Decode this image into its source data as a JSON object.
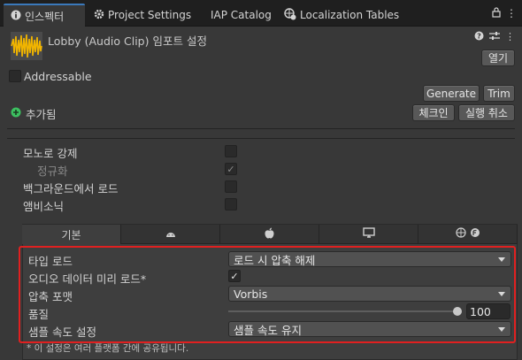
{
  "tabs": [
    {
      "label": "인스펙터",
      "icon": "info-icon"
    },
    {
      "label": "Project Settings",
      "icon": "gear-icon"
    },
    {
      "label": "IAP Catalog",
      "icon": ""
    },
    {
      "label": "Localization Tables",
      "icon": "globe-icon"
    }
  ],
  "header": {
    "title": "Lobby (Audio Clip) 임포트 설정",
    "open_label": "열기",
    "addressable_label": "Addressable",
    "generate_label": "Generate",
    "trim_label": "Trim",
    "added_label": "추가됨",
    "checkin_label": "체크인",
    "undo_label": "실행 취소"
  },
  "settings": {
    "mono_label": "모노로 강제",
    "mono_checked": false,
    "normalize_label": "정규화",
    "normalize_checked": true,
    "background_label": "백그라운드에서 로드",
    "background_checked": false,
    "ambisonic_label": "앰비소닉",
    "ambisonic_checked": false
  },
  "platform_tabs": [
    {
      "label": "기본",
      "icon": ""
    },
    {
      "label": "",
      "icon": "android-icon"
    },
    {
      "label": "",
      "icon": "apple-icon"
    },
    {
      "label": "",
      "icon": "monitor-icon"
    },
    {
      "label": "",
      "icon": "webgl-icon"
    }
  ],
  "platform_settings": {
    "load_type_label": "타입 로드",
    "load_type_value": "로드 시 압축 해제",
    "preload_label": "오디오 데이터 미리 로드*",
    "preload_checked": true,
    "compression_label": "압축 포맷",
    "compression_value": "Vorbis",
    "quality_label": "품질",
    "quality_value": "100",
    "quality_fraction": 1.0,
    "sample_rate_label": "샘플 속도 설정",
    "sample_rate_value": "샘플 속도 유지"
  },
  "footnote": "* 이 설정은 여러 플랫폼 간에 공유됩니다.",
  "colors": {
    "highlight": "#e02020",
    "accent": "#3a79bb",
    "asset_icon": "#f0b400",
    "added_icon": "#3cc060"
  }
}
